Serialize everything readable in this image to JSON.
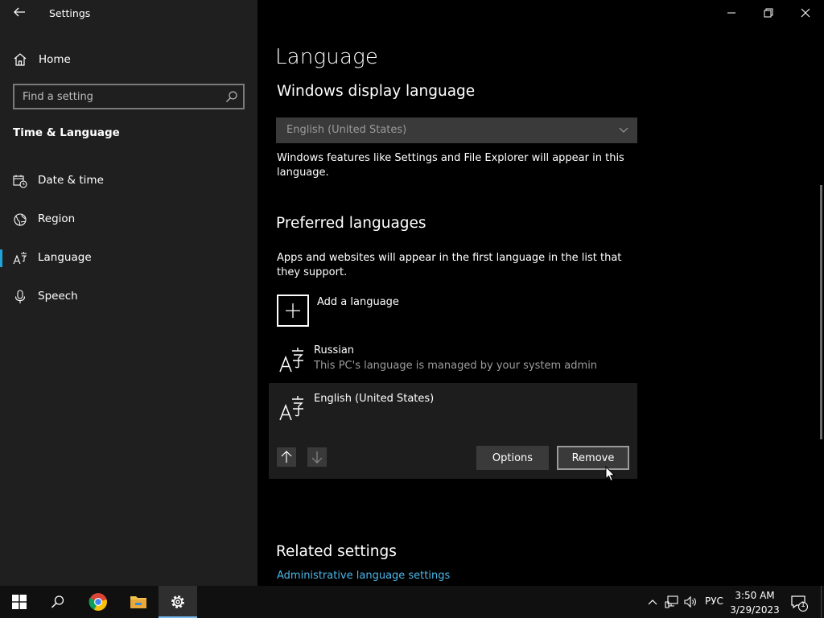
{
  "window": {
    "title": "Settings",
    "controls": {
      "minimize": "minimize-icon",
      "restore": "restore-icon",
      "close": "close-icon"
    }
  },
  "sidebar": {
    "home_label": "Home",
    "search_placeholder": "Find a setting",
    "section_title": "Time & Language",
    "items": [
      {
        "label": "Date & time",
        "icon": "calendar-clock-icon",
        "selected": false
      },
      {
        "label": "Region",
        "icon": "globe-icon",
        "selected": false
      },
      {
        "label": "Language",
        "icon": "language-icon",
        "selected": true
      },
      {
        "label": "Speech",
        "icon": "microphone-icon",
        "selected": false
      }
    ]
  },
  "main": {
    "title": "Language",
    "display_language": {
      "heading": "Windows display language",
      "selected": "English (United States)",
      "description": "Windows features like Settings and File Explorer will appear in this language."
    },
    "preferred": {
      "heading": "Preferred languages",
      "description": "Apps and websites will appear in the first language in the list that they support.",
      "add_label": "Add a language",
      "languages": [
        {
          "name": "Russian",
          "note": "This PC's language is managed by your system admin"
        },
        {
          "name": "English (United States)",
          "note": ""
        }
      ],
      "options_label": "Options",
      "remove_label": "Remove"
    },
    "related": {
      "heading": "Related settings",
      "link": "Administrative language settings"
    }
  },
  "taskbar": {
    "apps": [
      "start-icon",
      "search-icon",
      "chrome-icon",
      "file-explorer-icon",
      "settings-icon"
    ],
    "tray_lang": "РУС",
    "time": "3:50 AM",
    "date": "3/29/2023",
    "notification_count": "1"
  },
  "colors": {
    "accent": "#20a2da",
    "link": "#4bb7e8",
    "sidebar_bg": "#1f1f1f",
    "main_bg": "#000000"
  }
}
